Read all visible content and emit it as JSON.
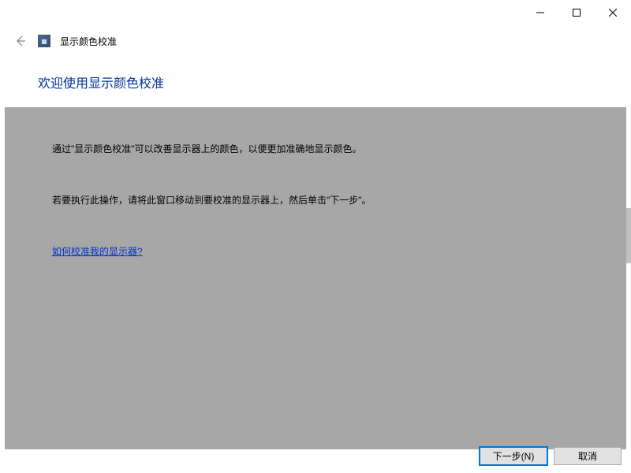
{
  "window": {
    "title": "显示颜色校准"
  },
  "heading": "欢迎使用显示颜色校准",
  "body": {
    "p1": "通过\"显示颜色校准\"可以改善显示器上的颜色，以便更加准确地显示颜色。",
    "p2": "若要执行此操作，请将此窗口移动到要校准的显示器上，然后单击\"下一步\"。",
    "help_link": "如何校准我的显示器?"
  },
  "buttons": {
    "next": "下一步(N)",
    "cancel": "取消"
  }
}
